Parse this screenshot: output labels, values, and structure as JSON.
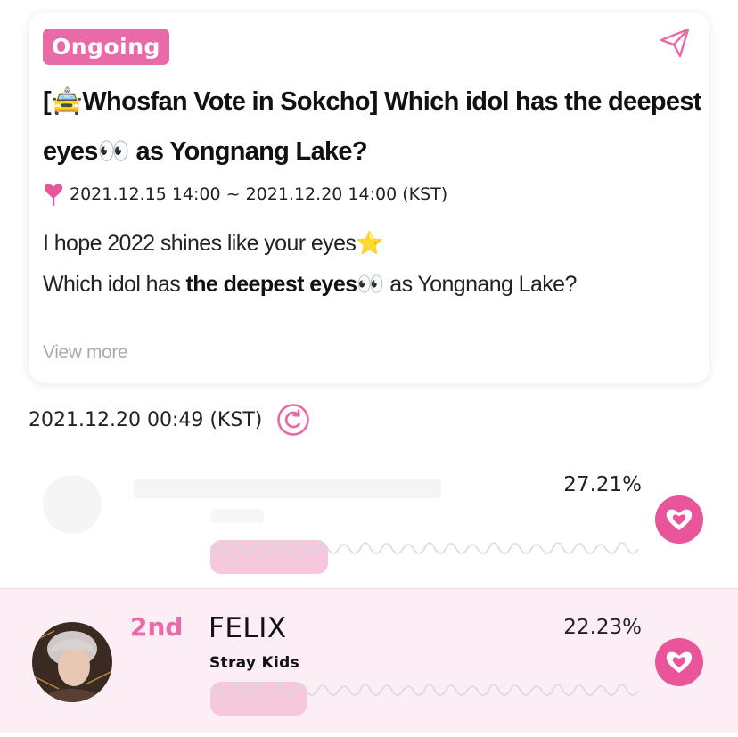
{
  "vote": {
    "status_badge": "Ongoing",
    "title_prefix": "[",
    "title_emoji1": "🚖",
    "title_part1": "Whosfan Vote in Sokcho] Which idol has the deepest eyes",
    "title_emoji2": "👀",
    "title_part2": " as Yongnang Lake?",
    "period": "2021.12.15 14:00 ~ 2021.12.20 14:00 (KST)",
    "desc_line1": "I hope 2022 shines like your eyes",
    "desc_line1_emoji": "⭐",
    "desc_line2_a": "Which idol has ",
    "desc_line2_b": "the deepest eyes",
    "desc_line2_emoji": "👀",
    "desc_line2_c": " as Yongnang Lake?",
    "view_more": "View more"
  },
  "results": {
    "timestamp": "2021.12.20 00:49 (KST)",
    "entries": [
      {
        "rank": "",
        "name": "",
        "group": "",
        "percent": "27.21%",
        "percent_value": 27.21
      },
      {
        "rank": "2nd",
        "name": "FELIX",
        "group": "Stray Kids",
        "percent": "22.23%",
        "percent_value": 22.23
      }
    ]
  },
  "colors": {
    "accent": "#e86aa6",
    "heart_button": "#e9559a",
    "highlight_row": "#fdeef6"
  },
  "icons": {
    "share": "send-icon",
    "refresh": "refresh-icon",
    "period": "pin-heart-icon",
    "vote": "heart-icon"
  }
}
